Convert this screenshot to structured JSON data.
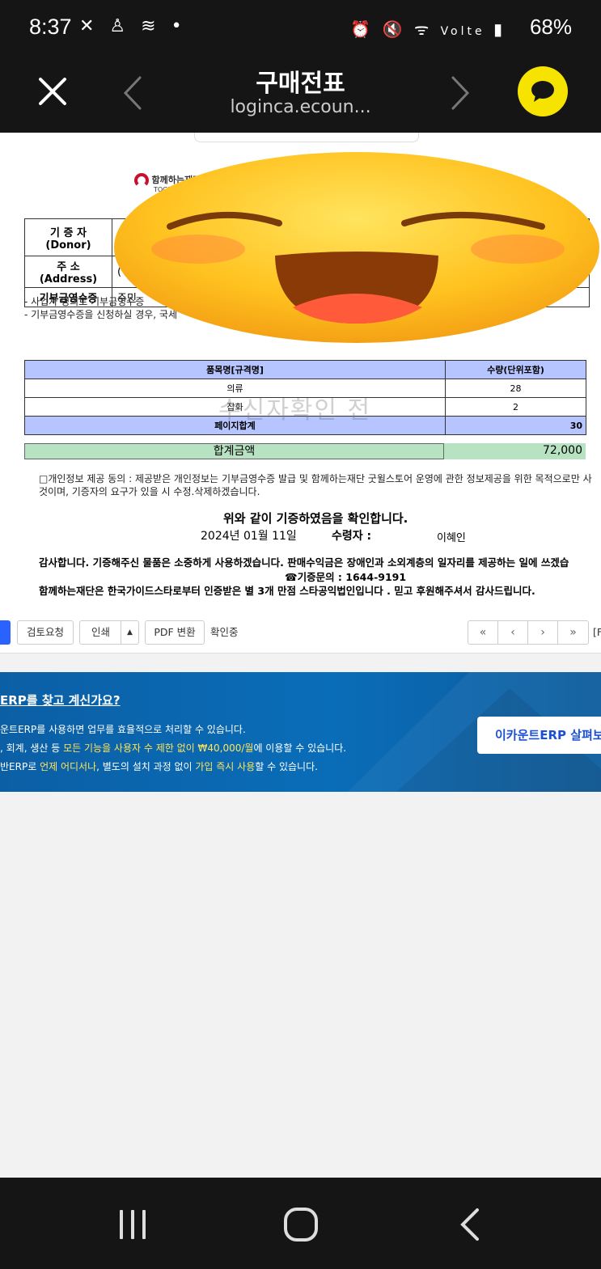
{
  "status_bar": {
    "time": "8:37",
    "battery": "68%",
    "network": "Volte"
  },
  "app_bar": {
    "title": "구매전표",
    "url": "loginca.ecoun..."
  },
  "document": {
    "logo_text": "함께하는재단",
    "logo_sub": "TOGETHER",
    "info_rows": [
      {
        "label": "기 증 자(Donor)",
        "value": ""
      },
      {
        "label": "주  소(Address)",
        "value": "("
      },
      {
        "label": "기부금영수증",
        "value": "주민"
      }
    ],
    "notes": [
      "- 사업자 명의로 기부금영수증",
      "- 기부금영수증을 신청하실 경우, 국세"
    ],
    "items_table": {
      "headers": [
        "품목명[규격명]",
        "수량(단위포함)"
      ],
      "rows": [
        {
          "name": "의류",
          "qty": "28"
        },
        {
          "name": "잡화",
          "qty": "2"
        }
      ],
      "page_total_label": "페이지합계",
      "page_total_value": "30"
    },
    "watermark": "수신자확인 전",
    "total_label": "합계금액",
    "total_value": "72,000",
    "consent_line1": "□개인정보 제공 동의 : 제공받은 개인정보는 기부금영수증 발급 및 함께하는재단 굿윌스토어 운영에 관한 정보제공을 위한 목적으로만 사",
    "consent_line2": "것이며, 기증자의 요구가 있을 시 수정.삭제하겠습니다.",
    "confirm_text": "위와 같이 기증하였음을 확인합니다.",
    "date_text": "2024년  01월  11일",
    "receiver_label": "수령자 :",
    "receiver_name": "이혜인",
    "thanks_line1": "감사합니다. 기증해주신 물품은 소중하게 사용하겠습니다. 판매수익금은 장애인과 소외계층의 일자리를 제공하는 일에 쓰겠습",
    "inquiry": "☎기증문의 : 1644-9191",
    "thanks_line2": "함께하는재단은 한국가이드스타로부터 인증받은 별 3개 만점 스타공익법인입니다 . 믿고 후원해주셔서 감사드립니다."
  },
  "toolbar": {
    "review_label": "검토요청",
    "print_label": "인쇄",
    "pdf_label": "PDF 변환",
    "status_label": "확인중",
    "pager_first": "«",
    "pager_prev": "‹",
    "pager_next": "›",
    "pager_last": "»",
    "pager_tail": "[F"
  },
  "banner": {
    "question": "ERP를 찾고 계신가요?",
    "line1": "운트ERP를 사용하면 업무를 효율적으로 처리할 수 있습니다.",
    "line2_a": ", 회계, 생산 등 ",
    "line2_hl": "모든 기능을 사용자 수 제한 없이 ₩40,000/월",
    "line2_b": "에 이용할 수 있습니다.",
    "line3_a": "반ERP로 ",
    "line3_hl1": "언제 어디서나",
    "line3_b": ", 별도의 설치 과정 없이 ",
    "line3_hl2": "가입 즉시 사용",
    "line3_c": "할 수 있습니다.",
    "cta": "이카운트ERP 살펴보"
  },
  "colors": {
    "table_header": "#b6c4ff",
    "total_row": "#b7e3c2",
    "banner_blue": "#0a6db8",
    "talk_yellow": "#f6e400"
  }
}
